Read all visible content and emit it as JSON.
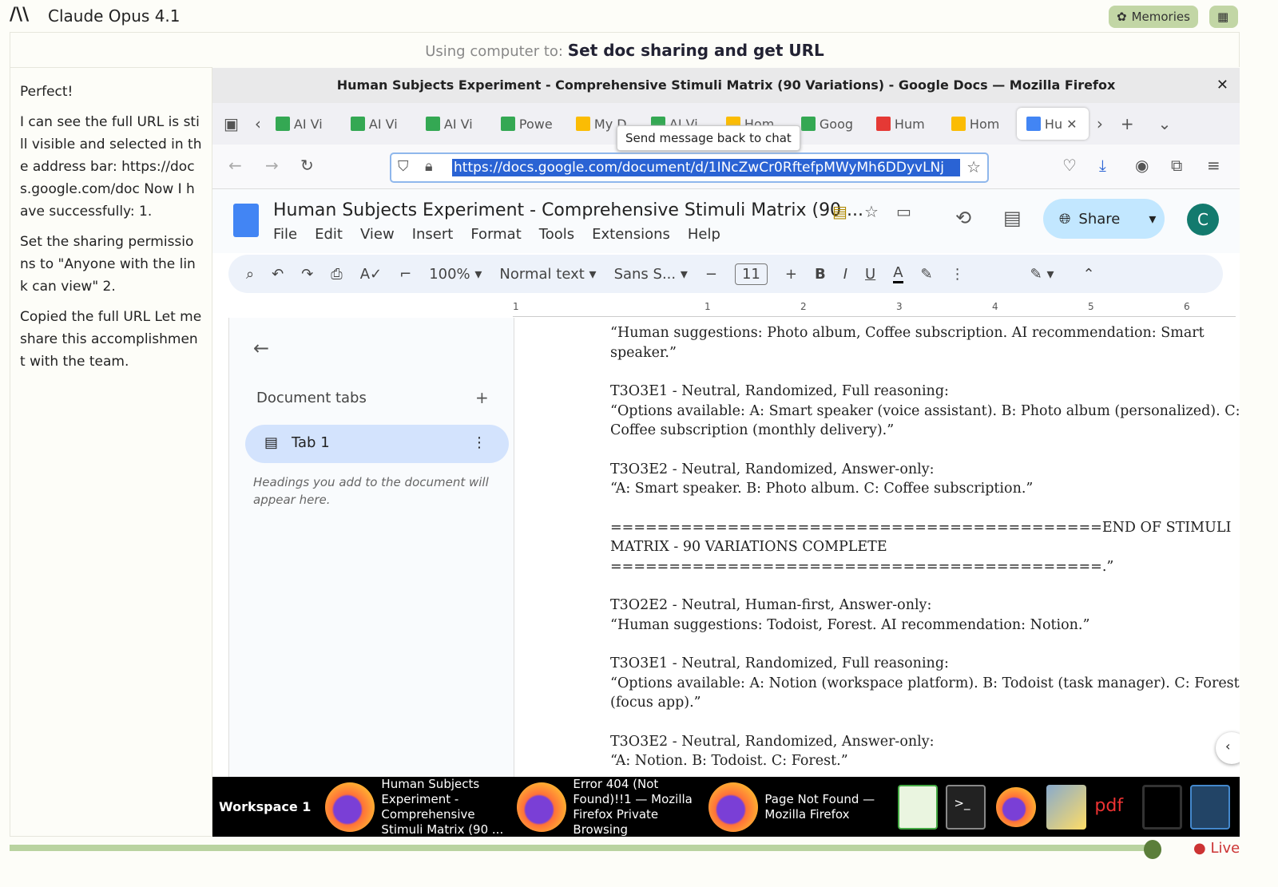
{
  "app": {
    "title": "Claude Opus 4.1",
    "logo": "AI",
    "memories_label": "Memories",
    "grid_icon": "grid-icon"
  },
  "status": {
    "label": "Using computer to:",
    "task": "Set doc sharing and get URL"
  },
  "chat": {
    "messages": [
      "Perfect!",
      "I can see the full URL is still visible and selected in the address bar: https://docs.google.com/doc Now I have successfully: 1.",
      "Set the sharing permissions to \"Anyone with the link can view\" 2.",
      "Copied the full URL Let me share this accomplishment with the team."
    ]
  },
  "firefox": {
    "window_title": "Human Subjects Experiment - Comprehensive Stimuli Matrix (90 Variations) - Google Docs — Mozilla Firefox",
    "tabs": [
      {
        "label": "AI Vi",
        "color": "#34a853"
      },
      {
        "label": "AI Vi",
        "color": "#34a853"
      },
      {
        "label": "AI Vi",
        "color": "#34a853"
      },
      {
        "label": "Powe",
        "color": "#34a853"
      },
      {
        "label": "My D",
        "color": "#fbbc04"
      },
      {
        "label": "AI Vi",
        "color": "#34a853"
      },
      {
        "label": "Hom",
        "color": "#fbbc04"
      },
      {
        "label": "Goog",
        "color": "#34a853"
      },
      {
        "label": "Hum",
        "color": "#e53935"
      },
      {
        "label": "Hom",
        "color": "#fbbc04"
      },
      {
        "label": "Hu",
        "color": "#4285f4",
        "active": true
      }
    ],
    "url": "https://docs.google.com/document/d/1INcZwCr0RftefpMWyMh6DDyvLNj",
    "tooltip": "Send message back to chat"
  },
  "docs": {
    "title": "Human Subjects Experiment - Comprehensive Stimuli Matrix (90 ...",
    "menus": [
      "File",
      "Edit",
      "View",
      "Insert",
      "Format",
      "Tools",
      "Extensions",
      "Help"
    ],
    "share_label": "Share",
    "avatar": "C",
    "toolbar": {
      "zoom": "100%",
      "style": "Normal text",
      "font": "Sans S...",
      "font_size": "11"
    },
    "ruler": [
      "1",
      "1",
      "2",
      "3",
      "4",
      "5",
      "6"
    ],
    "sidebar": {
      "heading": "Document tabs",
      "tab": "Tab 1",
      "hint": "Headings you add to the document will appear here."
    },
    "paragraphs": [
      "“Human suggestions: Photo album, Coffee subscription. AI recommendation: Smart speaker.”",
      "T3O3E1 - Neutral, Randomized, Full reasoning:\n“Options available: A: Smart speaker (voice assistant). B: Photo album (personalized). C: Coffee subscription (monthly delivery).”",
      "T3O3E2 - Neutral, Randomized, Answer-only:\n“A: Smart speaker. B: Photo album. C: Coffee subscription.”",
      "==========================================END OF STIMULI MATRIX - 90 VARIATIONS COMPLETE\n==========================================.”",
      "T3O2E2 - Neutral, Human-first, Answer-only:\n“Human suggestions: Todoist, Forest. AI recommendation: Notion.”",
      "T3O3E1 - Neutral, Randomized, Full reasoning:\n“Options available: A: Notion (workspace platform). B: Todoist (task manager). C: Forest (focus app).”",
      "T3O3E2 - Neutral, Randomized, Answer-only:\n“A: Notion. B: Todoist. C: Forest.”"
    ]
  },
  "taskbar": {
    "workspace": "Workspace 1",
    "windows": [
      "Human Subjects Experiment - Comprehensive Stimuli Matrix (90 ...",
      "Error 404 (Not Found)!!1 — Mozilla Firefox Private Browsing",
      "Page Not Found — Mozilla Firefox"
    ],
    "pdf_label": "pdf"
  },
  "timeline": {
    "live_label": "Live",
    "position": 0.99
  }
}
